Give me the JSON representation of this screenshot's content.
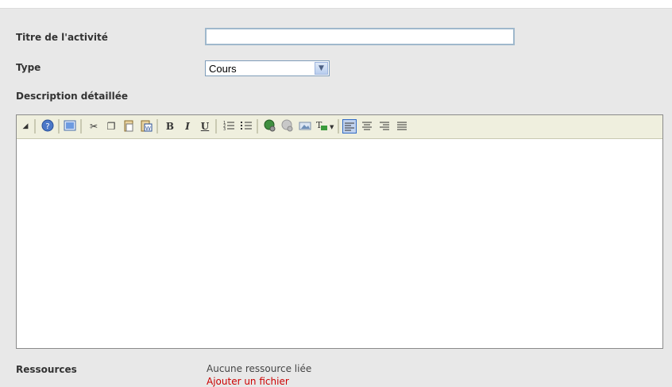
{
  "form": {
    "title_label": "Titre de l'activité",
    "title_value": "",
    "type_label": "Type",
    "type_value": "Cours",
    "description_label": "Description détaillée",
    "resources_label": "Ressources",
    "resources_value": "Aucune ressource liée",
    "resources_link": "Ajouter un fichier"
  },
  "toolbar": {
    "icons": [
      "collapse-icon",
      "help-icon",
      "source-icon",
      "cut-icon",
      "copy-icon",
      "paste-icon",
      "paste-word-icon",
      "bold-icon",
      "italic-icon",
      "underline-icon",
      "ordered-list-icon",
      "unordered-list-icon",
      "link-icon",
      "unlink-icon",
      "image-icon",
      "text-color-icon",
      "align-left-icon",
      "align-center-icon",
      "align-right-icon",
      "justify-icon"
    ],
    "bold": "B",
    "italic": "I",
    "underline": "U"
  },
  "colors": {
    "accent": "#316ac5",
    "toolbar_bg": "#efefde",
    "link": "#cc0000"
  }
}
